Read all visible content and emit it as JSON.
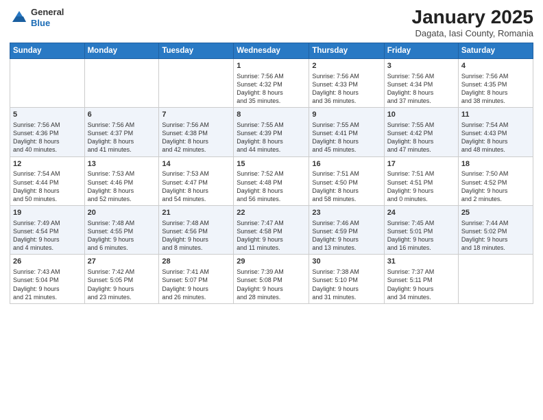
{
  "logo": {
    "line1": "General",
    "line2": "Blue"
  },
  "header": {
    "month": "January 2025",
    "location": "Dagata, Iasi County, Romania"
  },
  "weekdays": [
    "Sunday",
    "Monday",
    "Tuesday",
    "Wednesday",
    "Thursday",
    "Friday",
    "Saturday"
  ],
  "weeks": [
    [
      {
        "day": "",
        "content": ""
      },
      {
        "day": "",
        "content": ""
      },
      {
        "day": "",
        "content": ""
      },
      {
        "day": "1",
        "content": "Sunrise: 7:56 AM\nSunset: 4:32 PM\nDaylight: 8 hours\nand 35 minutes."
      },
      {
        "day": "2",
        "content": "Sunrise: 7:56 AM\nSunset: 4:33 PM\nDaylight: 8 hours\nand 36 minutes."
      },
      {
        "day": "3",
        "content": "Sunrise: 7:56 AM\nSunset: 4:34 PM\nDaylight: 8 hours\nand 37 minutes."
      },
      {
        "day": "4",
        "content": "Sunrise: 7:56 AM\nSunset: 4:35 PM\nDaylight: 8 hours\nand 38 minutes."
      }
    ],
    [
      {
        "day": "5",
        "content": "Sunrise: 7:56 AM\nSunset: 4:36 PM\nDaylight: 8 hours\nand 40 minutes."
      },
      {
        "day": "6",
        "content": "Sunrise: 7:56 AM\nSunset: 4:37 PM\nDaylight: 8 hours\nand 41 minutes."
      },
      {
        "day": "7",
        "content": "Sunrise: 7:56 AM\nSunset: 4:38 PM\nDaylight: 8 hours\nand 42 minutes."
      },
      {
        "day": "8",
        "content": "Sunrise: 7:55 AM\nSunset: 4:39 PM\nDaylight: 8 hours\nand 44 minutes."
      },
      {
        "day": "9",
        "content": "Sunrise: 7:55 AM\nSunset: 4:41 PM\nDaylight: 8 hours\nand 45 minutes."
      },
      {
        "day": "10",
        "content": "Sunrise: 7:55 AM\nSunset: 4:42 PM\nDaylight: 8 hours\nand 47 minutes."
      },
      {
        "day": "11",
        "content": "Sunrise: 7:54 AM\nSunset: 4:43 PM\nDaylight: 8 hours\nand 48 minutes."
      }
    ],
    [
      {
        "day": "12",
        "content": "Sunrise: 7:54 AM\nSunset: 4:44 PM\nDaylight: 8 hours\nand 50 minutes."
      },
      {
        "day": "13",
        "content": "Sunrise: 7:53 AM\nSunset: 4:46 PM\nDaylight: 8 hours\nand 52 minutes."
      },
      {
        "day": "14",
        "content": "Sunrise: 7:53 AM\nSunset: 4:47 PM\nDaylight: 8 hours\nand 54 minutes."
      },
      {
        "day": "15",
        "content": "Sunrise: 7:52 AM\nSunset: 4:48 PM\nDaylight: 8 hours\nand 56 minutes."
      },
      {
        "day": "16",
        "content": "Sunrise: 7:51 AM\nSunset: 4:50 PM\nDaylight: 8 hours\nand 58 minutes."
      },
      {
        "day": "17",
        "content": "Sunrise: 7:51 AM\nSunset: 4:51 PM\nDaylight: 9 hours\nand 0 minutes."
      },
      {
        "day": "18",
        "content": "Sunrise: 7:50 AM\nSunset: 4:52 PM\nDaylight: 9 hours\nand 2 minutes."
      }
    ],
    [
      {
        "day": "19",
        "content": "Sunrise: 7:49 AM\nSunset: 4:54 PM\nDaylight: 9 hours\nand 4 minutes."
      },
      {
        "day": "20",
        "content": "Sunrise: 7:48 AM\nSunset: 4:55 PM\nDaylight: 9 hours\nand 6 minutes."
      },
      {
        "day": "21",
        "content": "Sunrise: 7:48 AM\nSunset: 4:56 PM\nDaylight: 9 hours\nand 8 minutes."
      },
      {
        "day": "22",
        "content": "Sunrise: 7:47 AM\nSunset: 4:58 PM\nDaylight: 9 hours\nand 11 minutes."
      },
      {
        "day": "23",
        "content": "Sunrise: 7:46 AM\nSunset: 4:59 PM\nDaylight: 9 hours\nand 13 minutes."
      },
      {
        "day": "24",
        "content": "Sunrise: 7:45 AM\nSunset: 5:01 PM\nDaylight: 9 hours\nand 16 minutes."
      },
      {
        "day": "25",
        "content": "Sunrise: 7:44 AM\nSunset: 5:02 PM\nDaylight: 9 hours\nand 18 minutes."
      }
    ],
    [
      {
        "day": "26",
        "content": "Sunrise: 7:43 AM\nSunset: 5:04 PM\nDaylight: 9 hours\nand 21 minutes."
      },
      {
        "day": "27",
        "content": "Sunrise: 7:42 AM\nSunset: 5:05 PM\nDaylight: 9 hours\nand 23 minutes."
      },
      {
        "day": "28",
        "content": "Sunrise: 7:41 AM\nSunset: 5:07 PM\nDaylight: 9 hours\nand 26 minutes."
      },
      {
        "day": "29",
        "content": "Sunrise: 7:39 AM\nSunset: 5:08 PM\nDaylight: 9 hours\nand 28 minutes."
      },
      {
        "day": "30",
        "content": "Sunrise: 7:38 AM\nSunset: 5:10 PM\nDaylight: 9 hours\nand 31 minutes."
      },
      {
        "day": "31",
        "content": "Sunrise: 7:37 AM\nSunset: 5:11 PM\nDaylight: 9 hours\nand 34 minutes."
      },
      {
        "day": "",
        "content": ""
      }
    ]
  ]
}
